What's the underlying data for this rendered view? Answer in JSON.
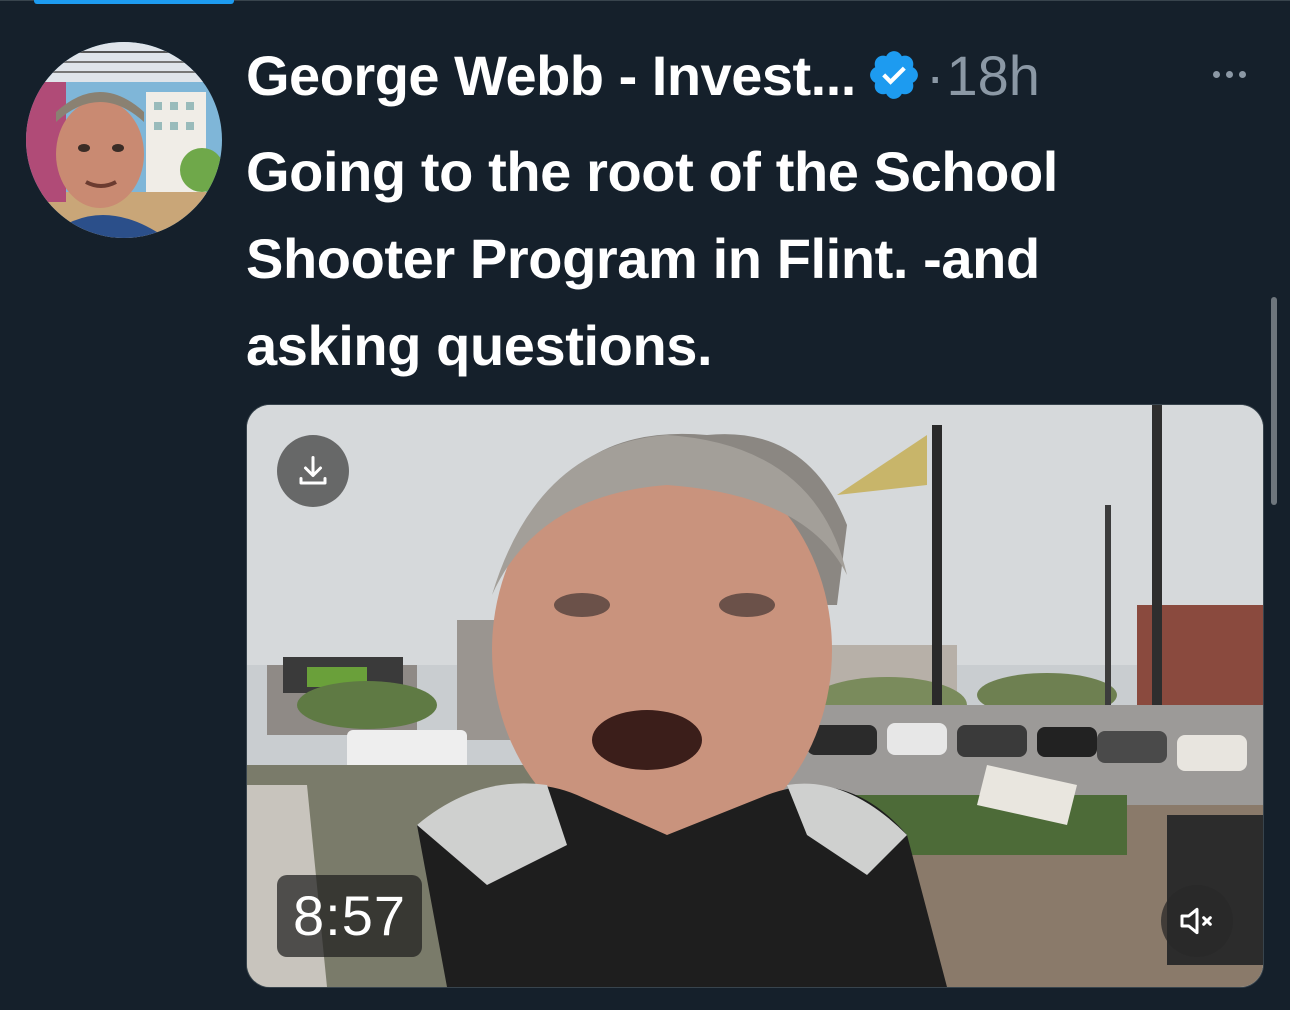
{
  "author": {
    "name": "George Webb - Invest...",
    "verified": true,
    "separator": "·",
    "time": "18h",
    "avatar_icon": "profile-photo-avatar"
  },
  "tweet": {
    "text": "Going to the root of the School Shooter Program in Flint. -and asking questions."
  },
  "video": {
    "duration": "8:57",
    "download_icon": "download-icon",
    "mute_icon": "muted-speaker-icon"
  },
  "more_icon": "more-options-icon",
  "colors": {
    "background": "#15202b",
    "verified_blue": "#1d9bf0",
    "secondary_text": "#8b98a5"
  }
}
